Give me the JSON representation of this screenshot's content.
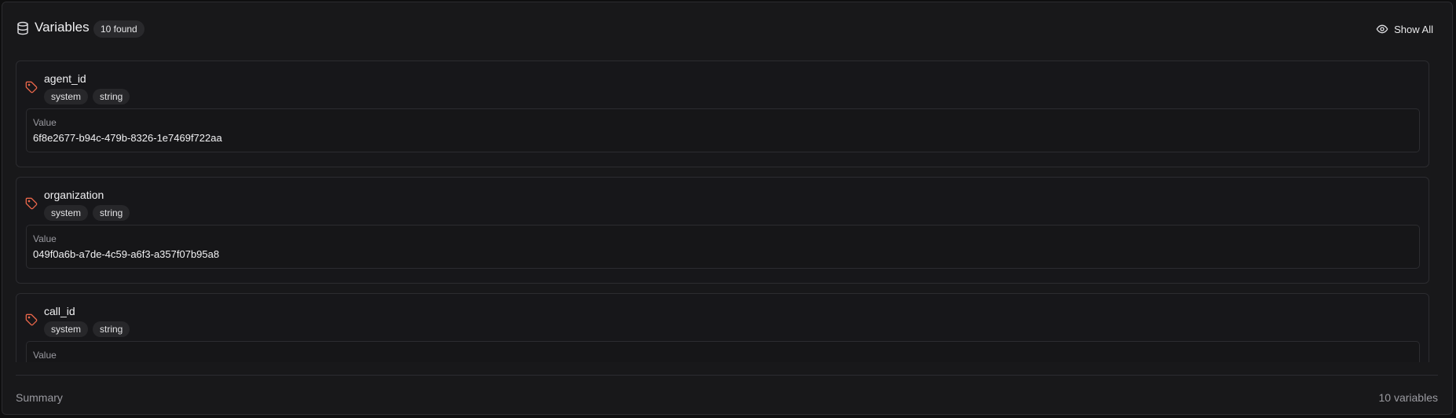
{
  "header": {
    "title": "Variables",
    "count_badge": "10 found",
    "show_all_label": "Show All",
    "icon": "database-icon"
  },
  "variables": [
    {
      "name": "agent_id",
      "tags": [
        "system",
        "string"
      ],
      "value_label": "Value",
      "value": "6f8e2677-b94c-479b-8326-1e7469f722aa"
    },
    {
      "name": "organization",
      "tags": [
        "system",
        "string"
      ],
      "value_label": "Value",
      "value": "049f0a6b-a7de-4c59-a6f3-a357f07b95a8"
    },
    {
      "name": "call_id",
      "tags": [
        "system",
        "string"
      ],
      "value_label": "Value",
      "value": ""
    }
  ],
  "footer": {
    "summary_label": "Summary",
    "summary_count": "10 variables"
  },
  "colors": {
    "accent_tag_icon": "#e8664a",
    "panel_bg": "#18181a",
    "page_bg": "#0f0f10"
  }
}
